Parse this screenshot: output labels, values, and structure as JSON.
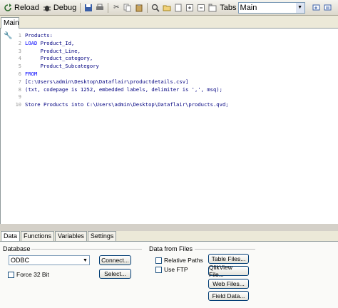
{
  "toolbar": {
    "reload_label": "Reload",
    "debug_label": "Debug",
    "tabs_label": "Tabs",
    "tabs_select_value": "Main"
  },
  "main_tab": {
    "label": "Main"
  },
  "editor": {
    "lines": [
      {
        "num": "1",
        "text": "Products:",
        "kind": "plain"
      },
      {
        "num": "2",
        "text": "LOAD Product_Id,",
        "kind": "load"
      },
      {
        "num": "3",
        "text": "     Product_Line,",
        "kind": "plain"
      },
      {
        "num": "4",
        "text": "     Product_category,",
        "kind": "plain"
      },
      {
        "num": "5",
        "text": "     Product_Subcategory",
        "kind": "plain"
      },
      {
        "num": "6",
        "text": "FROM",
        "kind": "kw"
      },
      {
        "num": "7",
        "text": "[C:\\Users\\admin\\Desktop\\Dataflair\\productdetails.csv]",
        "kind": "plain"
      },
      {
        "num": "8",
        "text": "(txt, codepage is 1252, embedded labels, delimiter is ',', msq);",
        "kind": "plain"
      },
      {
        "num": "9",
        "text": "",
        "kind": "plain"
      },
      {
        "num": "10",
        "text": "Store Products into C:\\Users\\admin\\Desktop\\Dataflair\\products.qvd;",
        "kind": "plain"
      }
    ]
  },
  "panel_tabs": [
    "Data",
    "Functions",
    "Variables",
    "Settings"
  ],
  "database": {
    "group_label": "Database",
    "connection_value": "ODBC",
    "connect_label": "Connect...",
    "select_label": "Select...",
    "force32_label": "Force 32 Bit"
  },
  "files": {
    "group_label": "Data from Files",
    "relative_paths_label": "Relative Paths",
    "use_ftp_label": "Use FTP",
    "table_files_label": "Table Files...",
    "qlikview_file_label": "QlikView File...",
    "web_files_label": "Web Files...",
    "field_data_label": "Field Data..."
  }
}
